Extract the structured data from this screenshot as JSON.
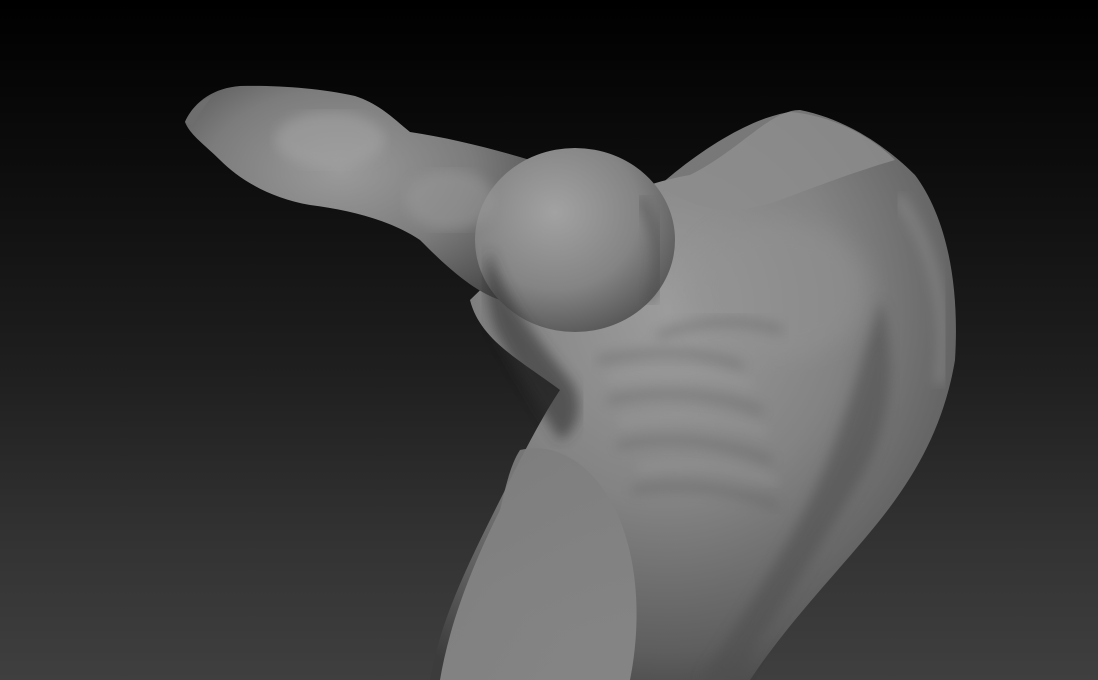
{
  "scene": {
    "subject": "sculpted-male-torso-with-raised-arm",
    "material": "matte-grey-clay",
    "colors": {
      "background_top": "#000000",
      "background_bottom": "#404040",
      "clay_highlight": "#9e9e9e",
      "clay_mid": "#7a7a7a",
      "clay_shadow": "#3a3a3a"
    }
  }
}
